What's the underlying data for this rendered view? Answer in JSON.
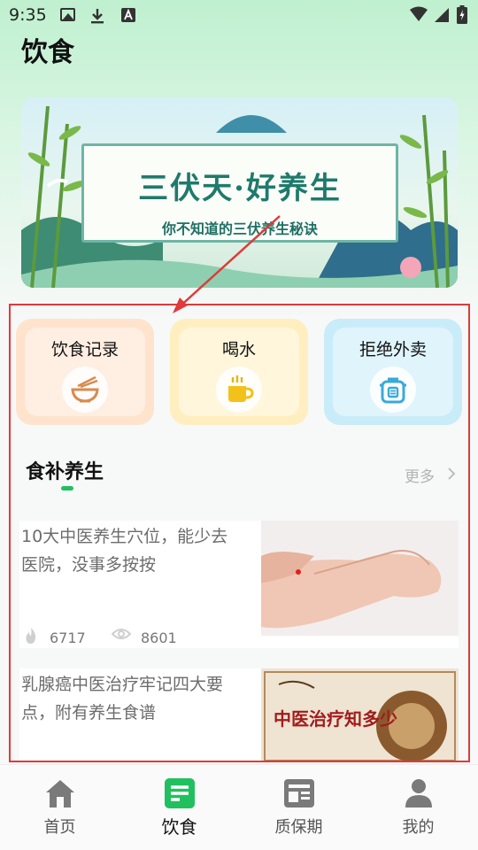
{
  "status_bar": {
    "time": "9:35",
    "icons": [
      "image-icon",
      "download-icon",
      "a-notification-icon",
      "wifi-icon",
      "cellular-icon",
      "battery-charging-icon"
    ]
  },
  "page": {
    "title": "饮食"
  },
  "banner": {
    "title": "三伏天·好养生",
    "subtitle": "你不知道的三伏养生秘诀"
  },
  "features": [
    {
      "label": "饮食记录",
      "icon": "bowl-icon",
      "color": "#d98a4e"
    },
    {
      "label": "喝水",
      "icon": "cup-icon",
      "color": "#e8b40f"
    },
    {
      "label": "拒绝外卖",
      "icon": "cooker-icon",
      "color": "#3aa9d9"
    }
  ],
  "section": {
    "title": "食补养生",
    "more": "更多"
  },
  "articles": [
    {
      "title": "10大中医养生穴位，能少去医院，没事多按按",
      "likes": "6717",
      "views": "8601"
    },
    {
      "title": "乳腺癌中医治疗牢记四大要点，附有养生食谱"
    }
  ],
  "nav": {
    "items": [
      {
        "label": "首页",
        "icon": "home-icon"
      },
      {
        "label": "饮食",
        "icon": "diet-icon"
      },
      {
        "label": "质保期",
        "icon": "shelf-life-icon"
      },
      {
        "label": "我的",
        "icon": "profile-icon"
      }
    ],
    "active_index": 1
  },
  "colors": {
    "accent": "#21c05f",
    "annotation": "#e03a3a"
  }
}
